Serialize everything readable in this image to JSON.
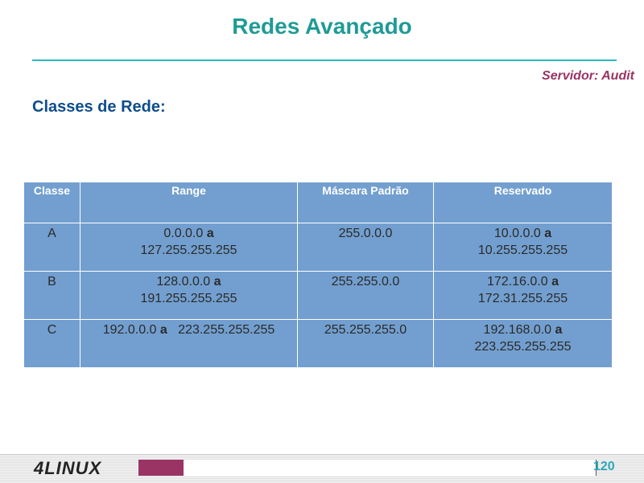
{
  "slide": {
    "title": "Redes Avançado",
    "server_label": "Servidor: Audit",
    "section_heading": "Classes de Rede:"
  },
  "table": {
    "headers": [
      "Classe",
      "Range",
      "Máscara Padrão",
      "Reservado"
    ],
    "rows": [
      {
        "classe": "A",
        "range_start": "0.0.0.0",
        "range_join": "a",
        "range_end": "127.255.255.255",
        "mask": "255.0.0.0",
        "reserved_start": "10.0.0.0",
        "reserved_join": "a",
        "reserved_end": "10.255.255.255"
      },
      {
        "classe": "B",
        "range_start": "128.0.0.0",
        "range_join": "a",
        "range_end": "191.255.255.255",
        "mask": "255.255.0.0",
        "reserved_start": "172.16.0.0",
        "reserved_join": "a",
        "reserved_end": "172.31.255.255"
      },
      {
        "classe": "C",
        "range_start": "192.0.0.0",
        "range_join": "a",
        "range_end": "223.255.255.255",
        "mask": "255.255.255.0",
        "reserved_start": "192.168.0.0",
        "reserved_join": "a",
        "reserved_end": "223.255.255.255"
      }
    ]
  },
  "footer": {
    "logo_text": "4LINUX",
    "page_number": "120"
  },
  "colors": {
    "title": "#1f9b95",
    "rule": "#27b8c4",
    "server": "#9a3464",
    "heading": "#0f4d8c",
    "table_bg": "#729fcf",
    "accent_box": "#9a3464",
    "page_number": "#2aa7b7"
  }
}
